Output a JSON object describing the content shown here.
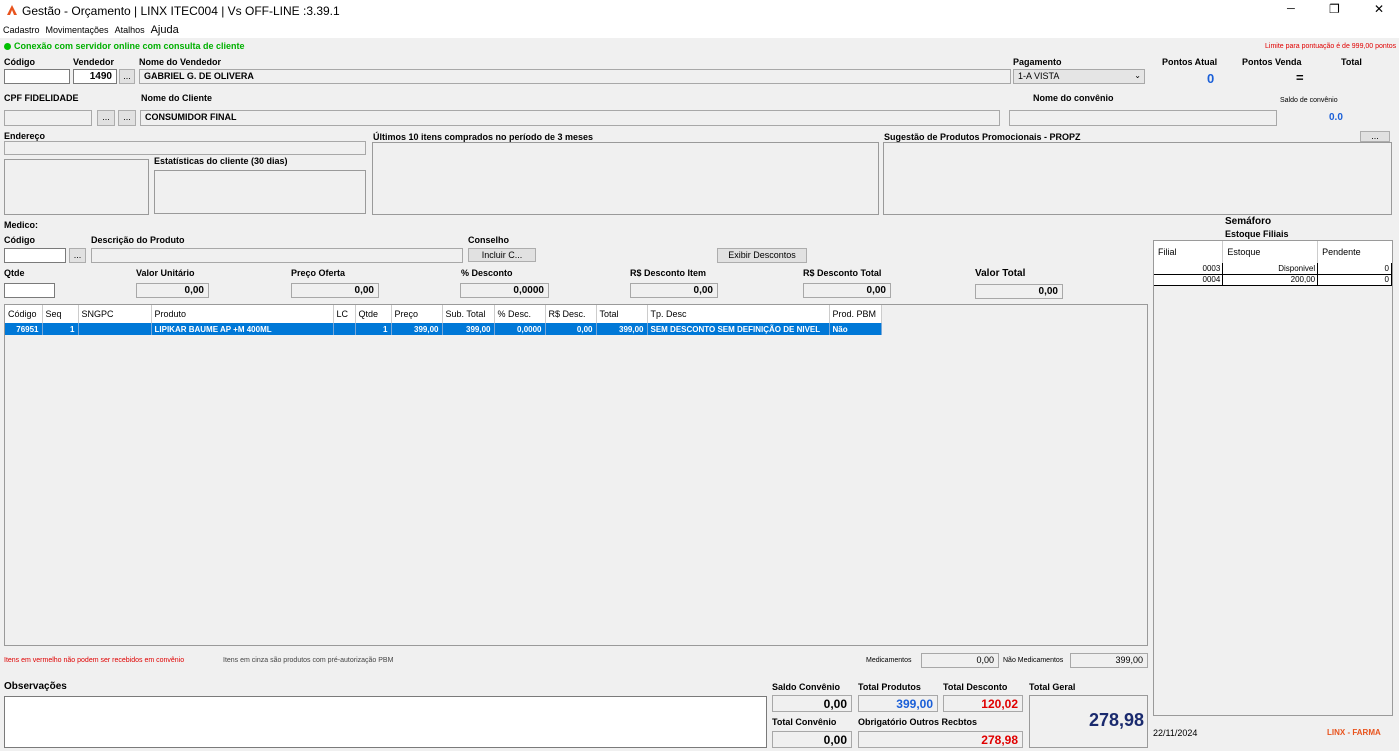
{
  "window": {
    "title": "Gestão - Orçamento  | LINX ITEC004 | Vs OFF-LINE :3.39.1",
    "minimize": "─",
    "restore": "❐",
    "close": "✕",
    "app_icon": "linx-logo-icon"
  },
  "menu": [
    "Cadastro",
    "Movimentações",
    "Atalhos",
    "Ajuda"
  ],
  "status": {
    "text": "Conexão com servidor online com consulta de cliente",
    "limit": "Limite para pontuação é de 999,00 pontos",
    "dot_color": "#00c000"
  },
  "header": {
    "codigo_label": "Código",
    "codigo_value": "",
    "vendedor_label": "Vendedor",
    "vendedor_value": "1490",
    "nome_vendedor_label": "Nome do Vendedor",
    "nome_vendedor_value": "GABRIEL G. DE OLIVERA",
    "pagamento_label": "Pagamento",
    "pagamento_value": "1-A VISTA",
    "pontos_atual_label": "Pontos Atual",
    "pontos_atual_value": "0",
    "pontos_venda_label": "Pontos Venda",
    "pontos_venda_value": "=",
    "total_label": "Total",
    "cpf_label": "CPF FIDELIDADE",
    "cpf_value": "",
    "nome_cliente_label": "Nome do Cliente",
    "nome_cliente_value": "CONSUMIDOR FINAL",
    "nome_convenio_label": "Nome do convênio",
    "nome_convenio_value": "",
    "saldo_convenio_label": "Saldo de convênio",
    "saldo_convenio_value": "0.0",
    "endereco_label": "Endereço",
    "estatisticas_label": "Estatísticas do cliente  (30 dias)",
    "ultimos_label": "Últimos 10 itens comprados no período de 3 meses",
    "sugestao_label": "Sugestão de Produtos Promocionais - PROPZ",
    "ellipsis": "..."
  },
  "product": {
    "medico_label": "Medico:",
    "codigo_label": "Código",
    "codigo_value": "",
    "descricao_label": "Descrição do Produto",
    "descricao_value": "",
    "conselho_label": "Conselho",
    "incluir_button": "Incluir C...",
    "exibir_button": "Exibir Descontos",
    "qtde_label": "Qtde",
    "qtde_value": "",
    "valor_unitario_label": "Valor Unitário",
    "valor_unitario_value": "0,00",
    "preco_oferta_label": "Preço Oferta",
    "preco_oferta_value": "0,00",
    "pct_desconto_label": "% Desconto",
    "pct_desconto_value": "0,0000",
    "rs_desconto_item_label": "R$ Desconto Item",
    "rs_desconto_item_value": "0,00",
    "rs_desconto_total_label": "R$ Desconto Total",
    "rs_desconto_total_value": "0,00",
    "valor_total_label": "Valor Total",
    "valor_total_value": "0,00"
  },
  "grid": {
    "columns": [
      "Código",
      "Seq",
      "SNGPC",
      "Produto",
      "LC",
      "Qtde",
      "Preço",
      "Sub. Total",
      "% Desc.",
      "R$ Desc.",
      "Total",
      "Tp. Desc",
      "Prod. PBM"
    ],
    "rows": [
      [
        "76951",
        "1",
        "",
        "LIPIKAR BAUME AP +M 400ML",
        "",
        "1",
        "399,00",
        "399,00",
        "0,0000",
        "0,00",
        "399,00",
        "SEM DESCONTO SEM DEFINIÇÃO DE NIVEL",
        "Não"
      ]
    ]
  },
  "semaforo": {
    "title": "Semáforo",
    "subtitle": "Estoque Filiais",
    "columns": [
      "Filial",
      "Estoque",
      "Pendente"
    ],
    "rows": [
      [
        "0003",
        "Disponivel",
        "0"
      ],
      [
        "0004",
        "200,00",
        "0"
      ]
    ]
  },
  "footer": {
    "red_note": "Itens em vermelho não podem ser recebidos em convênio",
    "gray_note": "Itens em cinza são produtos com pré-autorização PBM",
    "medicamentos_label": "Medicamentos",
    "medicamentos_value": "0,00",
    "nao_medicamentos_label": "Não Medicamentos",
    "nao_medicamentos_value": "399,00",
    "observacoes_label": "Observações",
    "saldo_convenio_label": "Saldo Convênio",
    "saldo_convenio_value": "0,00",
    "total_produtos_label": "Total Produtos",
    "total_produtos_value": "399,00",
    "total_desconto_label": "Total Desconto",
    "total_desconto_value": "120,02",
    "total_geral_label": "Total Geral",
    "total_geral_value": "278,98",
    "total_convenio_label": "Total Convênio",
    "total_convenio_value": "0,00",
    "obrigatorio_label": "Obrigatório Outros Recbtos",
    "obrigatorio_value": "278,98",
    "date": "22/11/2024",
    "brand": "LINX - FARMA"
  },
  "colors": {
    "accent_blue": "#1a5fd8",
    "red": "#e00000",
    "selection": "#0078d7",
    "navy": "#1a2a6e"
  }
}
